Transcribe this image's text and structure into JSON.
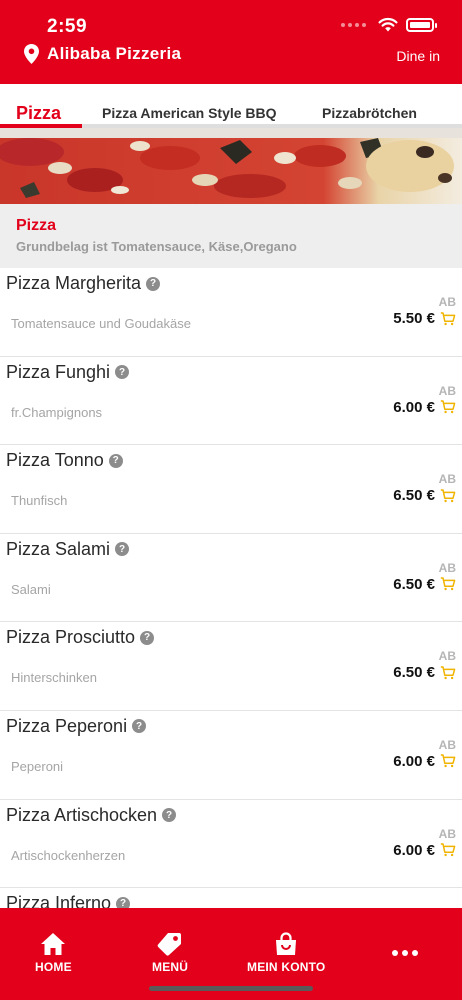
{
  "status_bar": {
    "time": "2:59"
  },
  "header": {
    "restaurant": "Alibaba Pizzeria",
    "mode": "Dine in"
  },
  "tabs": [
    {
      "label": "Pizza",
      "active": true
    },
    {
      "label": "Pizza American Style BBQ",
      "active": false
    },
    {
      "label": "Pizzabrötchen",
      "active": false
    }
  ],
  "category": {
    "title": "Pizza",
    "description": "Grundbelag ist Tomatensauce, Käse,Oregano"
  },
  "price_prefix": "AB",
  "items": [
    {
      "name": "Pizza Margherita",
      "description": "Tomatensauce und Goudakäse",
      "price": "5.50 €"
    },
    {
      "name": "Pizza Funghi",
      "description": "fr.Champignons",
      "price": "6.00 €"
    },
    {
      "name": "Pizza Tonno",
      "description": "Thunfisch",
      "price": "6.50 €"
    },
    {
      "name": "Pizza Salami",
      "description": "Salami",
      "price": "6.50 €"
    },
    {
      "name": "Pizza Prosciutto",
      "description": "Hinterschinken",
      "price": "6.50 €"
    },
    {
      "name": "Pizza Peperoni",
      "description": "Peperoni",
      "price": "6.00 €"
    },
    {
      "name": "Pizza Artischocken",
      "description": "Artischockenherzen",
      "price": "6.00 €"
    },
    {
      "name": "Pizza Inferno",
      "description": "",
      "price": ""
    }
  ],
  "bottom_nav": [
    {
      "label": "HOME",
      "icon": "home-icon"
    },
    {
      "label": "MENÜ",
      "icon": "tag-icon"
    },
    {
      "label": "MEIN KONTO",
      "icon": "shopping-bag-icon"
    },
    {
      "label": "",
      "icon": "more-icon"
    }
  ],
  "colors": {
    "brand_red": "#e2001a",
    "cart_icon": "#f0b400",
    "muted_text": "#a5a5a5"
  }
}
